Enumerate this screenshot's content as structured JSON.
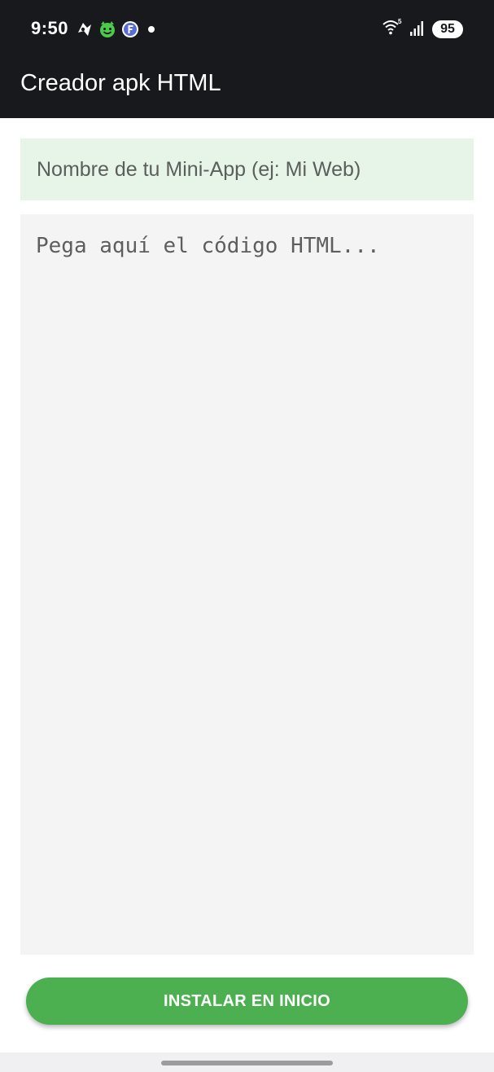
{
  "status_bar": {
    "time": "9:50",
    "battery": "95",
    "wifi_superscript": "5",
    "notification_icons": [
      "maps-icon",
      "happymod-icon",
      "f-droid-icon"
    ]
  },
  "app_bar": {
    "title": "Creador apk HTML"
  },
  "form": {
    "name_placeholder": "Nombre de tu Mini-App (ej: Mi Web)",
    "code_placeholder": "Pega aquí el código HTML...",
    "install_label": "INSTALAR EN INICIO"
  },
  "colors": {
    "app_bar": "#17191d",
    "name_input_bg": "#e7f5e8",
    "code_area_bg": "#f4f4f4",
    "accent_button": "#4caf50"
  }
}
